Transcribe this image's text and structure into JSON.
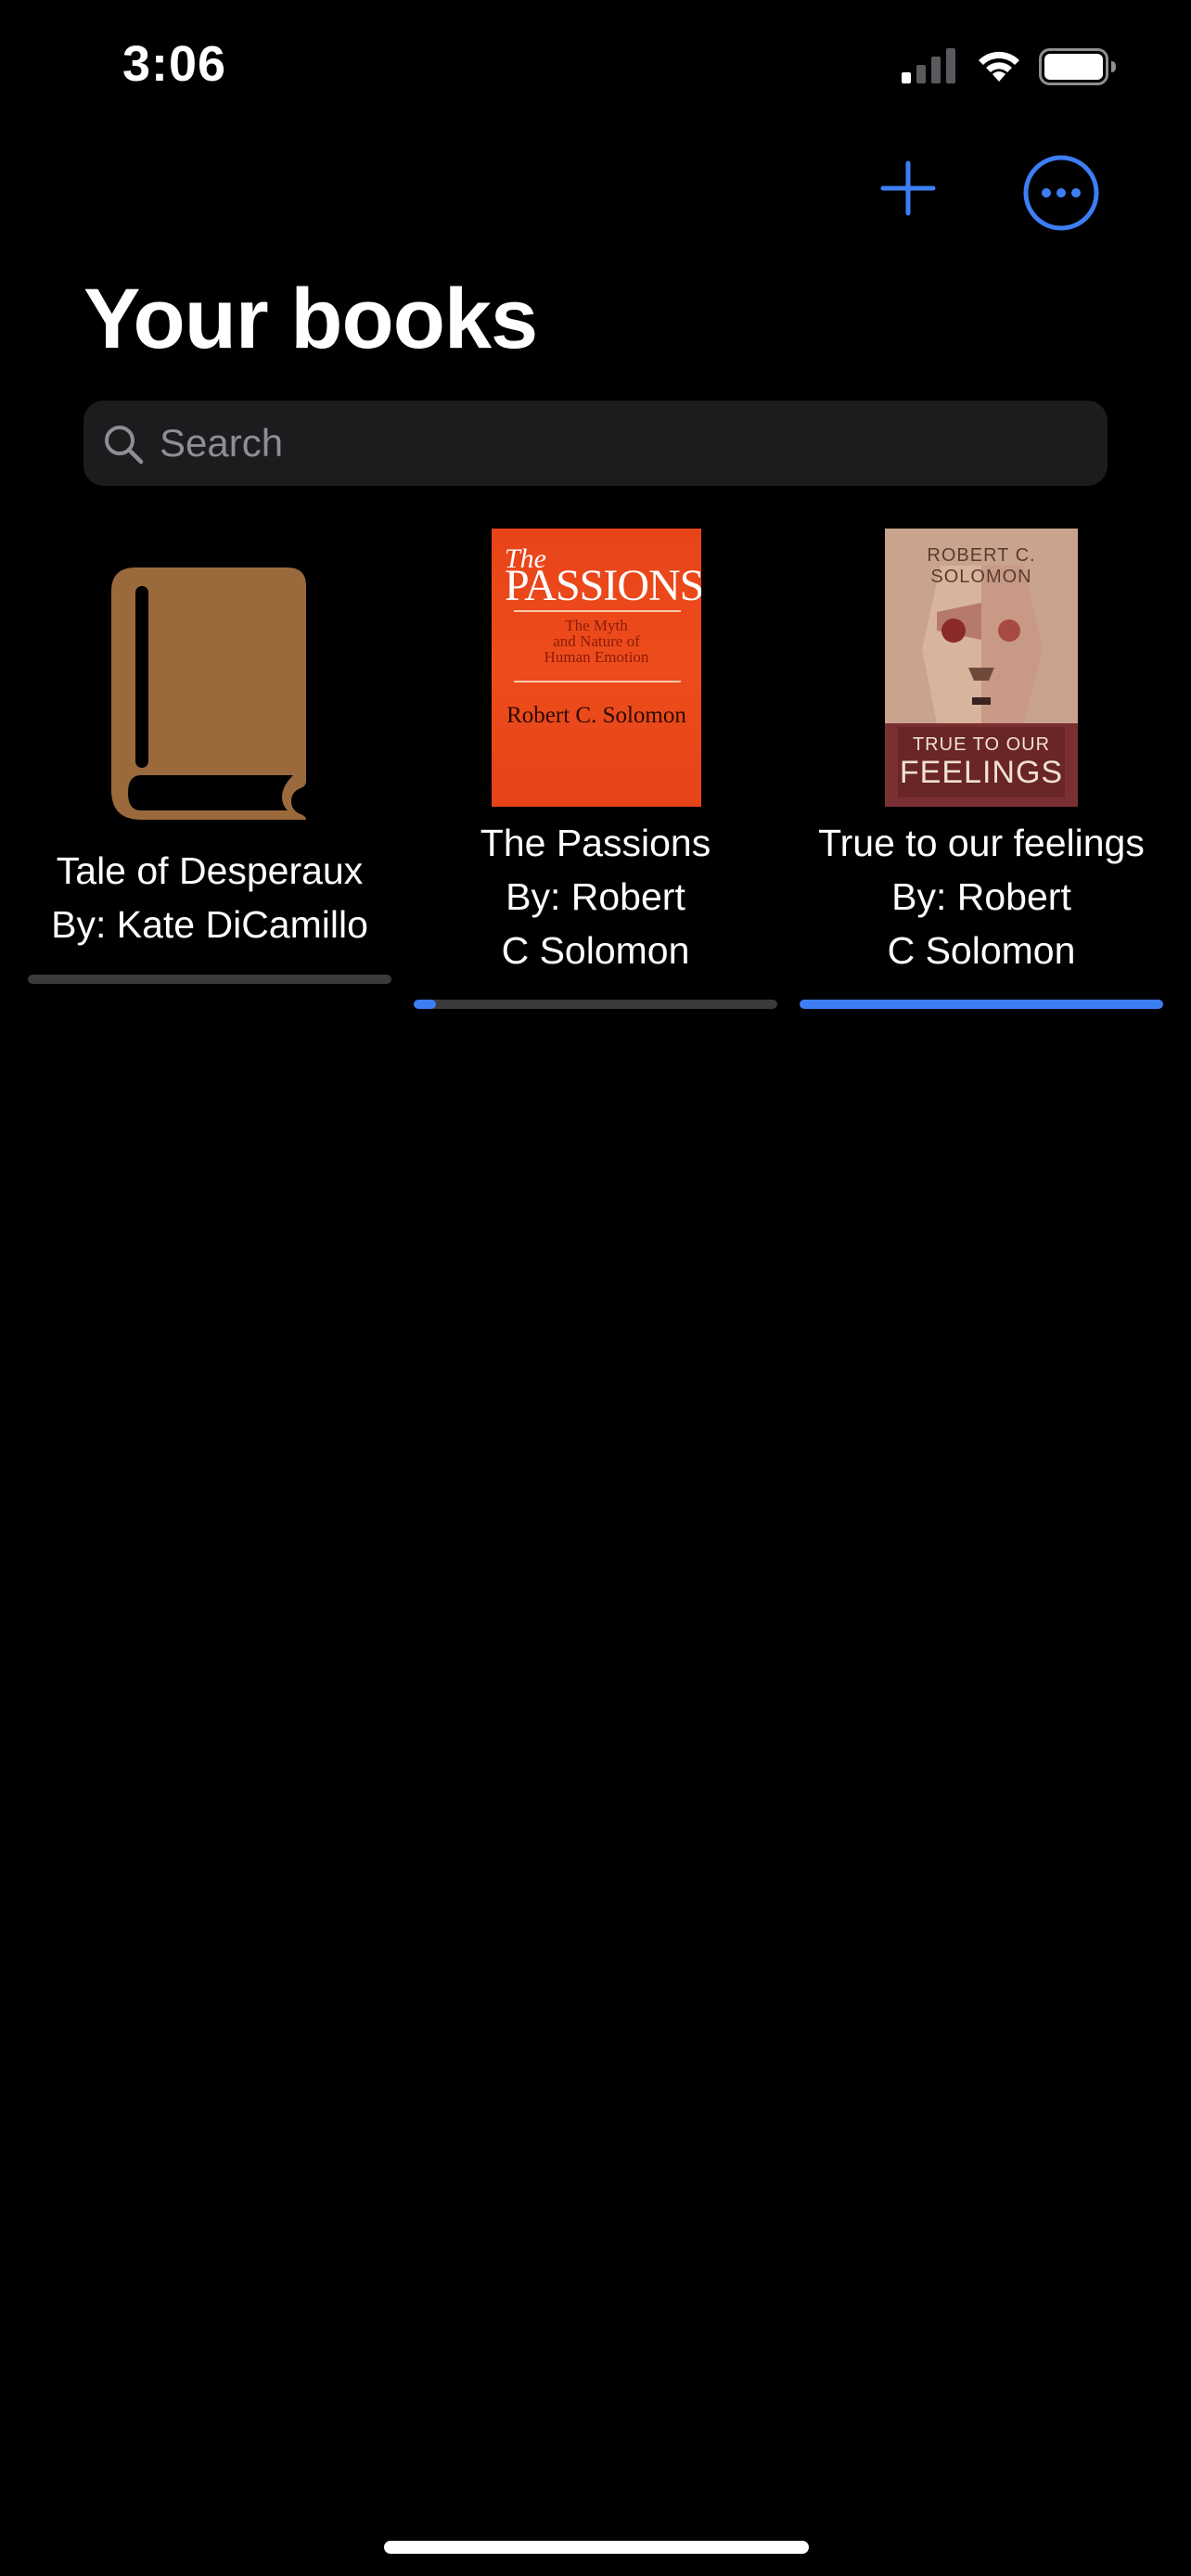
{
  "status_bar": {
    "time": "3:06"
  },
  "nav": {
    "add_icon": "plus-icon",
    "more_icon": "ellipsis-circle-icon",
    "accent_color": "#3d7ef5"
  },
  "header": {
    "title": "Your books"
  },
  "search": {
    "placeholder": "Search",
    "value": ""
  },
  "books": [
    {
      "title": "Tale of Desperaux",
      "author_line": "By: Kate DiCamillo",
      "cover": "book-placeholder-icon",
      "progress": 0
    },
    {
      "title": "The Passions",
      "author_line": "By: Robert\nC Solomon",
      "cover_text": {
        "the": "The",
        "title": "PASSIONS",
        "subtitle_1": "The Myth",
        "subtitle_2": "and Nature of",
        "subtitle_3": "Human Emotion",
        "author": "Robert C. Solomon"
      },
      "progress": 0.06
    },
    {
      "title": "True to our feelings",
      "author_line": "By: Robert\nC Solomon",
      "cover_text": {
        "author": "ROBERT C. SOLOMON",
        "title_1": "TRUE TO OUR",
        "title_2": "FEELINGS"
      },
      "progress": 1.0
    }
  ]
}
